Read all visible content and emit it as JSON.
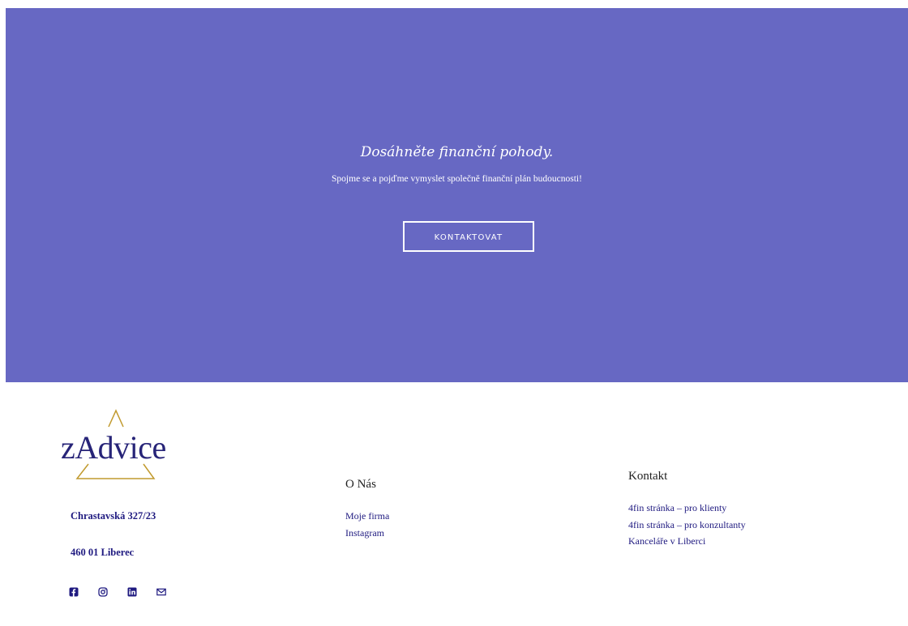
{
  "hero": {
    "title": "Dosáhněte finanční pohody.",
    "subtitle": "Spojme se a pojďme vymyslet společně finanční plán budoucnosti!",
    "cta_label": "KONTAKTOVAT",
    "background_color": "#6768c3"
  },
  "footer": {
    "logo": {
      "text": "zAdvice",
      "accent_color": "#c19a2e",
      "text_color": "#272478"
    },
    "address": {
      "line1": "Chrastavská 327/23",
      "line2": "460 01 Liberec"
    },
    "social": [
      {
        "icon": "facebook-icon"
      },
      {
        "icon": "instagram-icon"
      },
      {
        "icon": "linkedin-icon"
      },
      {
        "icon": "mail-icon"
      }
    ],
    "onas": {
      "title": "O Nás",
      "links": [
        "Moje firma",
        "Instagram"
      ]
    },
    "kontakt": {
      "title": "Kontakt",
      "links": [
        "4fin stránka – pro klienty",
        "4fin stránka – pro konzultanty",
        "Kanceláře v Liberci"
      ]
    },
    "link_color": "#1f1a80"
  }
}
